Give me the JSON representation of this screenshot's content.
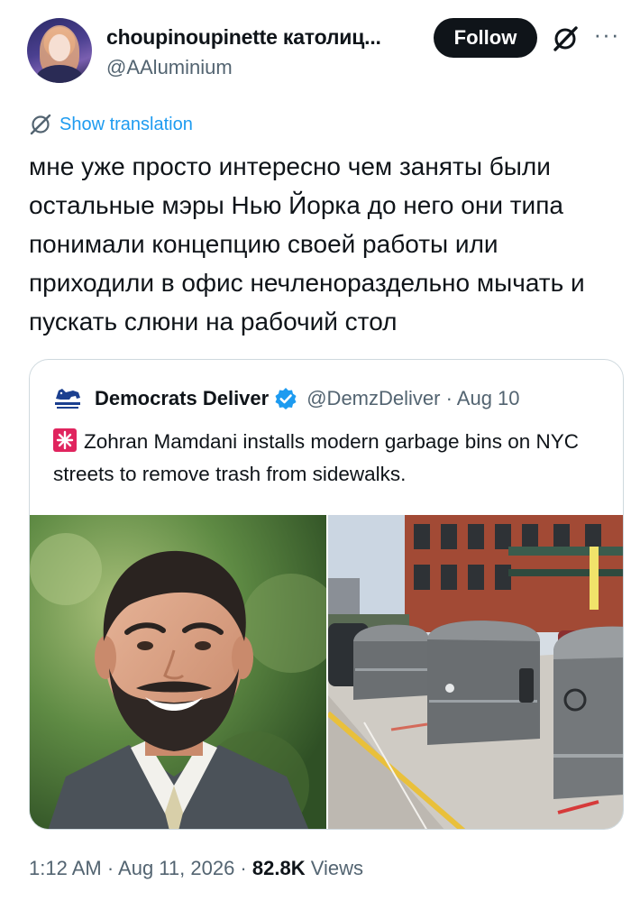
{
  "author": {
    "display_name": "choupinoupinette католиц...",
    "handle": "@AAluminium",
    "follow_label": "Follow",
    "more_label": "···"
  },
  "translation": {
    "label": "Show translation"
  },
  "tweet": {
    "text": "мне уже просто интересно чем заняты были остальные мэры Нью Йорка до него они типа понимали концепцию своей работы или приходили в офис нечленораздельно мычать и пускать слюни на рабочий стол"
  },
  "quoted_tweet": {
    "author_name": "Democrats Deliver",
    "handle_date": "@DemzDeliver · Aug 10",
    "text": "Zohran Mamdani installs modern garbage bins on NYC streets to remove trash from sidewalks.",
    "siren_icon": "police-light-emoji"
  },
  "footer": {
    "time_date": "1:12 AM · Aug 11, 2026 · ",
    "views_count": "82.8K",
    "views_label": " Views"
  },
  "colors": {
    "accent": "#1d9bf0",
    "text": "#0f1419",
    "secondary": "#536471",
    "border": "#cfd9de",
    "follow_bg": "#0f1419"
  }
}
